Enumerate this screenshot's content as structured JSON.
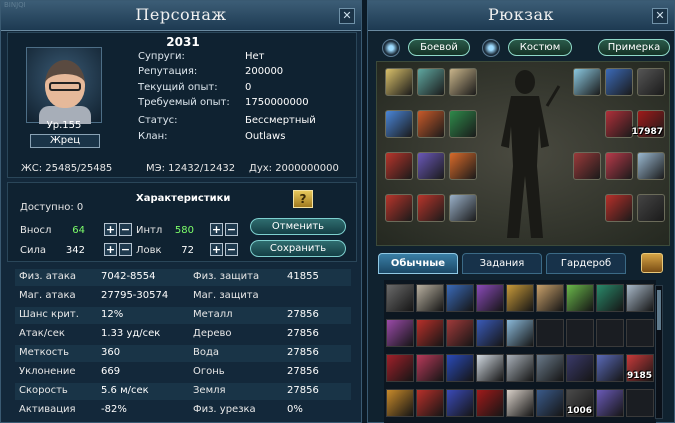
{
  "window_label": "BINJQI",
  "char": {
    "title": "Персонаж",
    "name": "2031",
    "level": "Ур.155",
    "class": "Жрец",
    "info": [
      {
        "label": "Супруги:",
        "value": "Нет"
      },
      {
        "label": "Репутация:",
        "value": "200000"
      },
      {
        "label": "Текущий опыт:",
        "value": "0"
      },
      {
        "label": "Требуемый опыт:",
        "value": "1750000000"
      },
      {
        "label": "Статус:",
        "value": "Бессмертный"
      },
      {
        "label": "Клан:",
        "value": "Outlaws"
      }
    ],
    "hp": "ЖС: 25485/25485",
    "mp": "МЭ: 12432/12432",
    "spirit": "Дух: 2000000000"
  },
  "stats": {
    "title": "Характеристики",
    "available": "Доступно: 0",
    "help": "?",
    "attrs": [
      {
        "label": "Вносл",
        "value": "64",
        "color": "#7dff6a"
      },
      {
        "label": "Сила",
        "value": "342",
        "color": "#ffffff"
      },
      {
        "label": "Интл",
        "value": "580",
        "color": "#7dff6a"
      },
      {
        "label": "Ловк",
        "value": "72",
        "color": "#ffffff"
      }
    ],
    "plus": "+",
    "minus": "−",
    "cancel": "Отменить",
    "save": "Сохранить"
  },
  "details": [
    {
      "l1": "Физ. атака",
      "v1": "7042-8554",
      "l2": "Физ. защита",
      "v2": "41855"
    },
    {
      "l1": "Маг. атака",
      "v1": "27795-30574",
      "l2": "Маг. защита",
      "v2": ""
    },
    {
      "l1": "Шанс крит.",
      "v1": "12%",
      "l2": "Металл",
      "v2": "27856"
    },
    {
      "l1": "Атак/сек",
      "v1": "1.33 уд/сек",
      "l2": "Дерево",
      "v2": "27856"
    },
    {
      "l1": "Меткость",
      "v1": "360",
      "l2": "Вода",
      "v2": "27856"
    },
    {
      "l1": "Уклонение",
      "v1": "669",
      "l2": "Огонь",
      "v2": "27856"
    },
    {
      "l1": "Скорость",
      "v1": "5.6 м/сек",
      "l2": "Земля",
      "v2": "27856"
    },
    {
      "l1": "Активация",
      "v1": "-82%",
      "l2": "Физ. урезка",
      "v2": "0%"
    }
  ],
  "bag": {
    "title": "Рюкзак",
    "battle": "Боевой",
    "costume": "Костюм",
    "tryon": "Примерка",
    "tabs": [
      "Обычные",
      "Задания",
      "Гардероб"
    ],
    "equip_counts": {
      "slot_amulet": "17987"
    },
    "grid_counts": {
      "r3c8": "9185",
      "r4c7": "1006"
    }
  },
  "colors": {
    "accent": "#8fd9c8",
    "panel": "#13283a",
    "highlight": "#7dff6a"
  }
}
